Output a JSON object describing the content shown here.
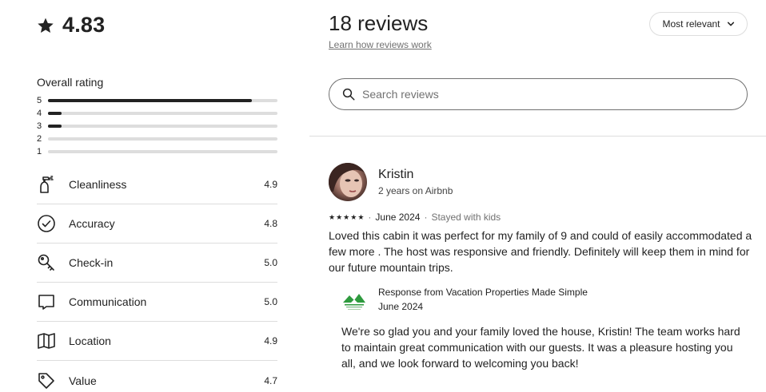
{
  "summary": {
    "overall_score": "4.83",
    "overall_rating_label": "Overall rating",
    "distribution": [
      {
        "stars": "5",
        "fraction": 0.89
      },
      {
        "stars": "4",
        "fraction": 0.06
      },
      {
        "stars": "3",
        "fraction": 0.06
      },
      {
        "stars": "2",
        "fraction": 0
      },
      {
        "stars": "1",
        "fraction": 0
      }
    ],
    "categories": [
      {
        "label": "Cleanliness",
        "value": "4.9",
        "icon": "spray-bottle-icon"
      },
      {
        "label": "Accuracy",
        "value": "4.8",
        "icon": "check-circle-icon"
      },
      {
        "label": "Check-in",
        "value": "5.0",
        "icon": "key-icon"
      },
      {
        "label": "Communication",
        "value": "5.0",
        "icon": "chat-bubble-icon"
      },
      {
        "label": "Location",
        "value": "4.9",
        "icon": "map-icon"
      },
      {
        "label": "Value",
        "value": "4.7",
        "icon": "tag-icon"
      }
    ]
  },
  "header": {
    "review_count": "18 reviews",
    "learn_link": "Learn how reviews work",
    "sort_label": "Most relevant"
  },
  "search": {
    "placeholder": "Search reviews"
  },
  "review": {
    "name": "Kristin",
    "tenure": "2 years on Airbnb",
    "rating": 5,
    "date": "June 2024",
    "trip_type": "Stayed with kids",
    "text": "Loved this cabin it was perfect for my family of 9 and could of easily accommodated a few more . The host was responsive and friendly. Definitely will keep them in mind for our future mountain trips.",
    "response": {
      "title": "Response from Vacation Properties Made Simple",
      "date": "June 2024",
      "text": "We're so glad you and your family loved the house, Kristin! The team works hard to maintain great communication with our guests. It was a pleasure hosting you all, and we look forward to welcoming you back!"
    }
  },
  "colors": {
    "text": "#222222",
    "muted": "#717171",
    "border": "#dddddd",
    "logo_green": "#2e9a3e"
  }
}
